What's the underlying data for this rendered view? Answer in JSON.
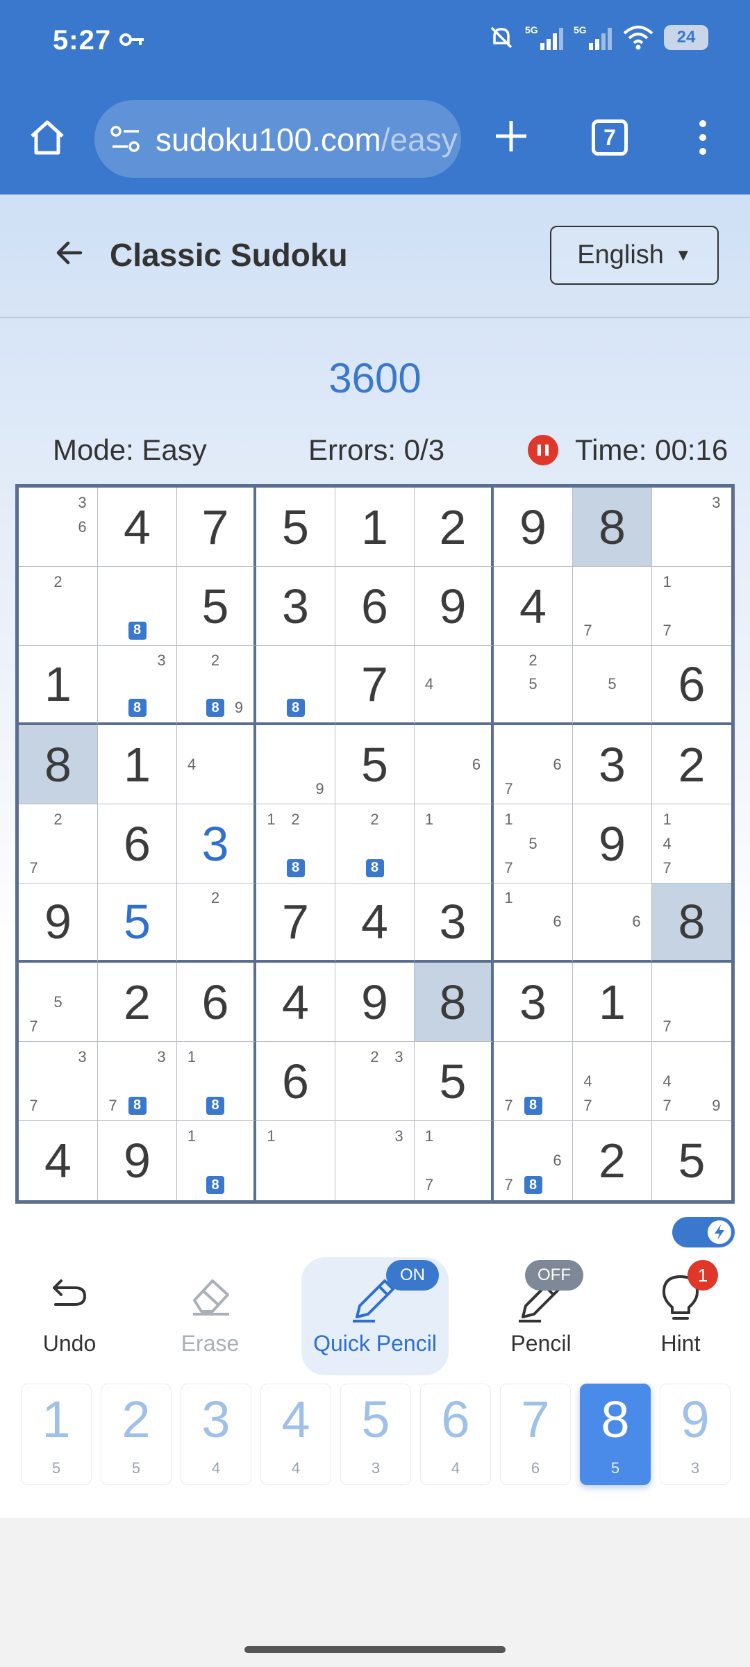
{
  "status_bar": {
    "time": "5:27",
    "signal_1": "5G",
    "signal_2": "5G",
    "battery": "24"
  },
  "browser": {
    "url_main": "sudoku100.com",
    "url_tail": "/easy",
    "tab_count": "7"
  },
  "header": {
    "title": "Classic Sudoku",
    "language": "English"
  },
  "stats": {
    "score": "3600",
    "mode": "Mode: Easy",
    "errors": "Errors: 0/3",
    "time": "Time: 00:16"
  },
  "board": {
    "values": [
      [
        0,
        4,
        7,
        5,
        1,
        2,
        9,
        8,
        0
      ],
      [
        0,
        0,
        5,
        3,
        6,
        9,
        4,
        0,
        0
      ],
      [
        1,
        0,
        0,
        0,
        7,
        0,
        0,
        0,
        6
      ],
      [
        8,
        1,
        0,
        0,
        5,
        0,
        0,
        3,
        2
      ],
      [
        0,
        6,
        3,
        0,
        0,
        0,
        0,
        9,
        0
      ],
      [
        9,
        5,
        0,
        7,
        4,
        3,
        0,
        0,
        8
      ],
      [
        0,
        2,
        6,
        4,
        9,
        8,
        3,
        1,
        0
      ],
      [
        0,
        0,
        0,
        6,
        0,
        5,
        0,
        0,
        0
      ],
      [
        4,
        9,
        0,
        0,
        0,
        0,
        0,
        2,
        5
      ]
    ],
    "user_entered": [
      [
        4,
        2
      ],
      [
        5,
        1
      ]
    ],
    "highlighted": [
      [
        0,
        7
      ],
      [
        3,
        0
      ],
      [
        5,
        8
      ],
      [
        6,
        5
      ]
    ],
    "notes": [
      [
        [
          3,
          6
        ],
        [],
        [],
        [],
        [],
        [],
        [],
        [],
        [
          3
        ]
      ],
      [
        [
          2
        ],
        [
          8
        ],
        [],
        [],
        [],
        [],
        [],
        [
          7
        ],
        [
          1,
          7
        ]
      ],
      [
        [],
        [
          3,
          8
        ],
        [
          2,
          8,
          9
        ],
        [
          8
        ],
        [],
        [
          4
        ],
        [
          2,
          5
        ],
        [
          5
        ],
        []
      ],
      [
        [],
        [],
        [
          4
        ],
        [
          9
        ],
        [],
        [
          6
        ],
        [
          6,
          7
        ],
        [],
        []
      ],
      [
        [
          2,
          7
        ],
        [],
        [],
        [
          1,
          2,
          8
        ],
        [
          2,
          8
        ],
        [
          1
        ],
        [
          1,
          5,
          7
        ],
        [],
        [
          1,
          4,
          7
        ]
      ],
      [
        [],
        [],
        [
          2
        ],
        [],
        [],
        [],
        [
          1,
          6
        ],
        [
          6
        ],
        []
      ],
      [
        [
          5,
          7
        ],
        [],
        [],
        [],
        [],
        [],
        [],
        [],
        [
          7
        ]
      ],
      [
        [
          3,
          7
        ],
        [
          3,
          7,
          8
        ],
        [
          1,
          8
        ],
        [],
        [
          2,
          3
        ],
        [],
        [
          7,
          8
        ],
        [
          4,
          7
        ],
        [
          4,
          7,
          9
        ]
      ],
      [
        [],
        [],
        [
          1,
          8
        ],
        [
          1
        ],
        [
          3
        ],
        [
          1,
          7
        ],
        [
          6,
          7,
          8
        ],
        [],
        []
      ]
    ]
  },
  "controls": {
    "undo": "Undo",
    "erase": "Erase",
    "quick_pencil": "Quick Pencil",
    "quick_pencil_state": "ON",
    "pencil": "Pencil",
    "pencil_state": "OFF",
    "hint": "Hint",
    "hint_count": "1"
  },
  "numpad": [
    {
      "digit": "1",
      "remaining": "5"
    },
    {
      "digit": "2",
      "remaining": "5"
    },
    {
      "digit": "3",
      "remaining": "4"
    },
    {
      "digit": "4",
      "remaining": "4"
    },
    {
      "digit": "5",
      "remaining": "3"
    },
    {
      "digit": "6",
      "remaining": "4"
    },
    {
      "digit": "7",
      "remaining": "6"
    },
    {
      "digit": "8",
      "remaining": "5"
    },
    {
      "digit": "9",
      "remaining": "3"
    }
  ],
  "numpad_selected": "8",
  "colors": {
    "accent": "#3a78cd",
    "highlight": "#c6d3e3",
    "alert": "#e0372b"
  }
}
